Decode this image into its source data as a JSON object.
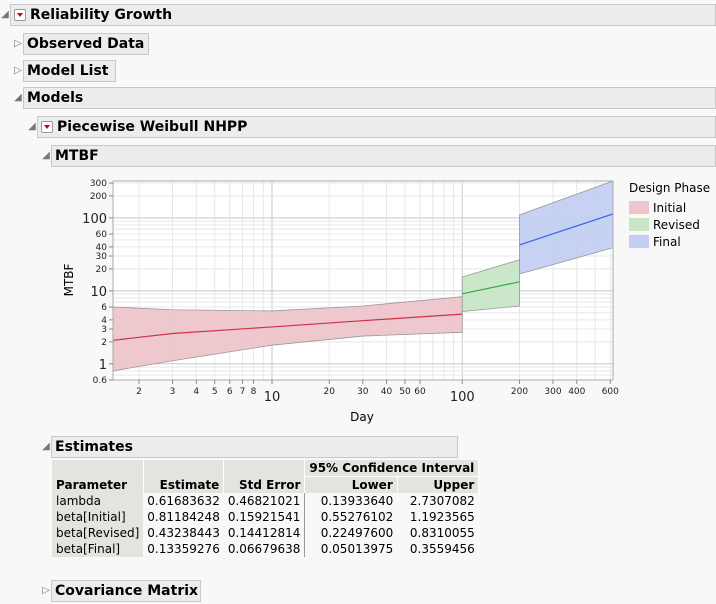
{
  "report": {
    "title": "Reliability Growth",
    "sections": {
      "observed_data": "Observed Data",
      "model_list": "Model List",
      "models": "Models",
      "model_name": "Piecewise Weibull NHPP",
      "mtbf": "MTBF",
      "estimates": "Estimates",
      "covariance": "Covariance Matrix"
    }
  },
  "chart_data": {
    "type": "area",
    "title": "MTBF",
    "xlabel": "Day",
    "ylabel": "MTBF",
    "xscale": "log",
    "yscale": "log",
    "xlim": [
      1.46,
      620
    ],
    "ylim": [
      0.6,
      320
    ],
    "grid": true,
    "x_ticks": [
      2,
      3,
      4,
      5,
      6,
      7,
      8,
      10,
      20,
      30,
      40,
      50,
      60,
      100,
      200,
      300,
      400,
      600
    ],
    "x_tick_labels": [
      "2",
      "3",
      "4",
      "5",
      "6",
      "7",
      "8",
      "10",
      "20",
      "30",
      "40",
      "50",
      "60",
      "100",
      "200",
      "300",
      "400",
      "600"
    ],
    "y_ticks": [
      0.6,
      1,
      2,
      3,
      4,
      6,
      10,
      20,
      30,
      40,
      60,
      100,
      200,
      300
    ],
    "y_tick_labels": [
      "0.6",
      "1",
      "2",
      "3",
      "4",
      "6",
      "10",
      "20",
      "30",
      "40",
      "60",
      "100",
      "200",
      "300"
    ],
    "legend": {
      "title": "Design Phase",
      "position": "right"
    },
    "series": [
      {
        "name": "Initial",
        "color": "#cc3344",
        "fill": "#eec5cb",
        "x": [
          1.46,
          3,
          10,
          30,
          100
        ],
        "mean": [
          2.1,
          2.6,
          3.2,
          3.9,
          4.8
        ],
        "lower": [
          0.8,
          1.1,
          1.8,
          2.4,
          2.7
        ],
        "upper": [
          6.0,
          5.5,
          5.3,
          6.2,
          8.3
        ]
      },
      {
        "name": "Revised",
        "color": "#33aa44",
        "fill": "#c8e6c6",
        "x": [
          100,
          200
        ],
        "mean": [
          9.1,
          13.3
        ],
        "lower": [
          5.2,
          6.2
        ],
        "upper": [
          15.5,
          26.6
        ]
      },
      {
        "name": "Final",
        "color": "#3366dd",
        "fill": "#c3cff2",
        "x": [
          200,
          620
        ],
        "mean": [
          42.6,
          113
        ],
        "lower": [
          17,
          39
        ],
        "upper": [
          110,
          320
        ]
      }
    ]
  },
  "estimates": {
    "group_header": "95% Confidence Interval",
    "columns": [
      "Parameter",
      "Estimate",
      "Std Error",
      "Lower",
      "Upper"
    ],
    "rows": [
      [
        "lambda",
        "0.61683632",
        "0.46821021",
        "0.13933640",
        "2.7307082"
      ],
      [
        "beta[Initial]",
        "0.81184248",
        "0.15921541",
        "0.55276102",
        "1.1923565"
      ],
      [
        "beta[Revised]",
        "0.43238443",
        "0.14412814",
        "0.22497600",
        "0.8310055"
      ],
      [
        "beta[Final]",
        "0.13359276",
        "0.06679638",
        "0.05013975",
        "0.3559456"
      ]
    ]
  }
}
